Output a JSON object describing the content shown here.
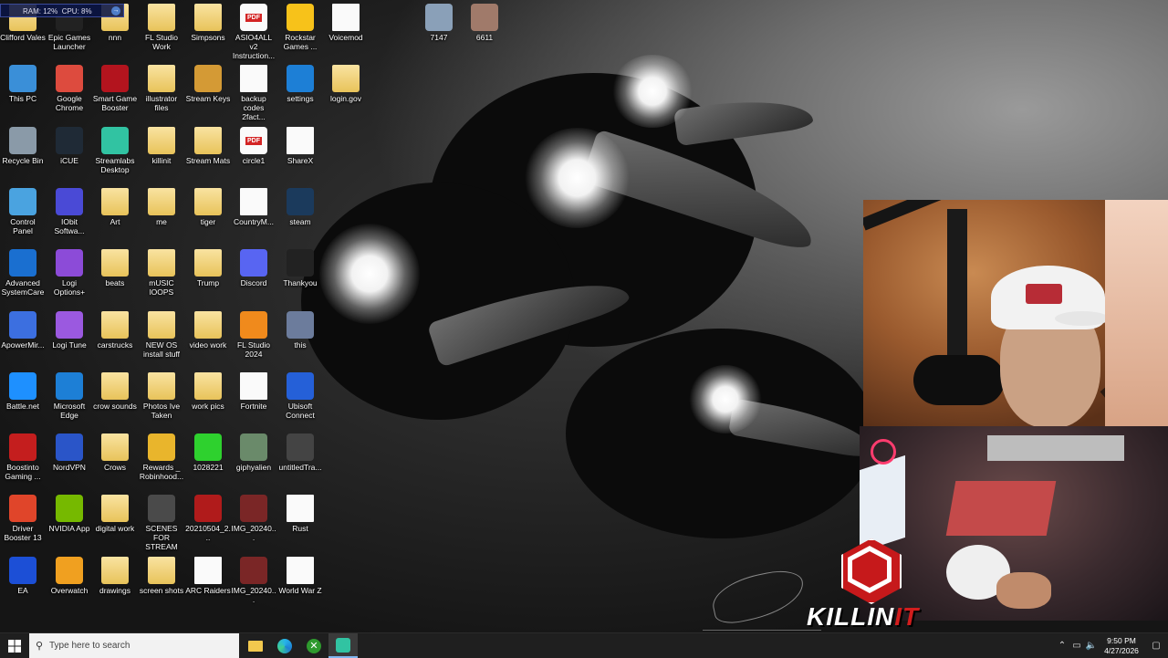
{
  "sysmon": {
    "ram": "RAM: 12%",
    "cpu": "CPU: 8%"
  },
  "desktop": {
    "col1": [
      "Clifford Vales",
      "This PC",
      "Recycle Bin",
      "Control Panel",
      "Advanced SystemCare",
      "ApowerMir...",
      "Battle.net",
      "Boostinto Gaming ...",
      "Driver Booster 13",
      "EA"
    ],
    "col2": [
      "Epic Games Launcher",
      "Google Chrome",
      "iCUE",
      "IObit Softwa...",
      "Logi Options+",
      "Logi Tune",
      "Microsoft Edge",
      "NordVPN",
      "NVIDIA App",
      "Overwatch"
    ],
    "col3": [
      "nnn",
      "Smart Game Booster",
      "Streamlabs Desktop",
      "Art",
      "beats",
      "carstrucks",
      "crow sounds",
      "Crows",
      "digital work",
      "drawings"
    ],
    "col4": [
      "FL Studio Work",
      "illustrator files",
      "killinit",
      "me",
      "mUSIC lOOPS",
      "NEW OS install stuff",
      "Photos Ive Taken",
      "Rewards _ Robinhood...",
      "SCENES FOR STREAM",
      "screen shots"
    ],
    "col5": [
      "Simpsons",
      "Stream Keys",
      "Stream Mats",
      "tiger",
      "Trump",
      "video work",
      "work pics",
      "1028221",
      "20210504_2...",
      "ARC Raiders"
    ],
    "col6": [
      "ASIO4ALL v2 Instruction...",
      "backup codes 2fact...",
      "circle1",
      "CountryM...",
      "Discord",
      "FL Studio 2024",
      "Fortnite",
      "giphyalien",
      "IMG_20240...",
      "IMG_20240..."
    ],
    "col7": [
      "Rockstar Games ...",
      "settings",
      "ShareX",
      "steam",
      "Thankyou",
      "this",
      "Ubisoft Connect",
      "untitledTra...",
      "Rust",
      "World War Z"
    ],
    "col8": [
      "Voicemod",
      "login.gov"
    ],
    "extra": [
      "7147",
      "6611"
    ]
  },
  "overlay": {
    "brand_a": "KILLIN",
    "brand_b": "IT"
  },
  "taskbar": {
    "search_placeholder": "Type here to search",
    "time": "9:50 PM",
    "date": "4/27/2026"
  },
  "colors": {
    "taskbar": "#1f1f1f",
    "accent": "#7fb6f0",
    "brand_red": "#c6191b"
  }
}
